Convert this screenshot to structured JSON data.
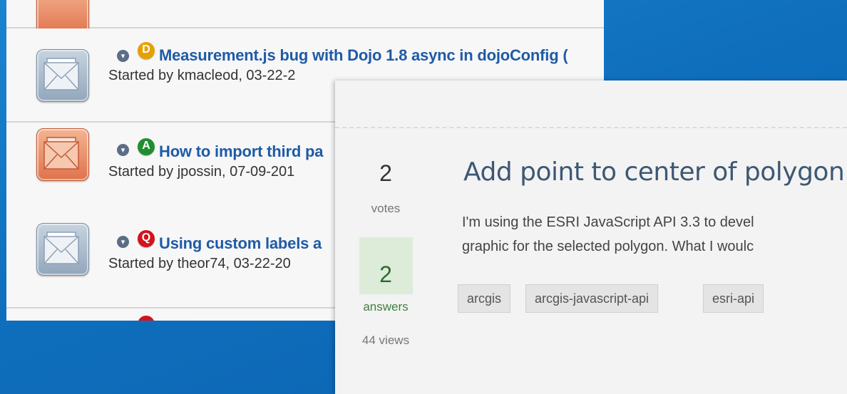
{
  "forum": {
    "threads": [
      {
        "badge": "D",
        "badge_color": "#e6a100",
        "title": "Measurement.js bug with Dojo 1.8 async in dojoConfig (",
        "meta": "Started by kmacleod, 03-22-2",
        "icon": "envelope-icon",
        "icon_color": "gray"
      },
      {
        "badge": "A",
        "badge_color": "#1e8f2e",
        "title": "How to import third pa",
        "meta": "Started by jpossin, 07-09-201",
        "icon": "envelope-icon",
        "icon_color": "orange"
      },
      {
        "badge": "Q",
        "badge_color": "#d4131b",
        "title": "Using custom labels a",
        "meta": "Started by theor74, 03-22-20",
        "icon": "envelope-icon",
        "icon_color": "gray"
      }
    ]
  },
  "question": {
    "votes": "2",
    "votes_label": "votes",
    "answers": "2",
    "answers_label": "answers",
    "views": "44 views",
    "title": "Add point to center of polygon",
    "excerpt_line1": "I'm using the ESRI JavaScript API 3.3 to devel",
    "excerpt_line2": "graphic for the selected polygon. What I woulc",
    "tags": [
      "arcgis",
      "arcgis-javascript-api",
      "esri-api"
    ],
    "answers_bg": "#dcecd9"
  }
}
